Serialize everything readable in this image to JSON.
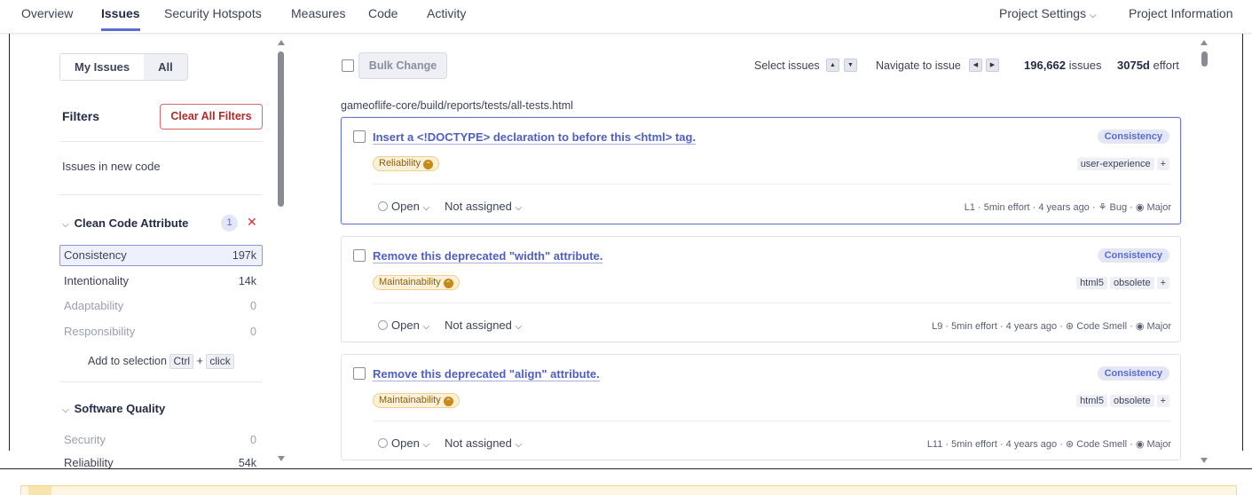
{
  "nav": {
    "tabs": [
      "Overview",
      "Issues",
      "Security Hotspots",
      "Measures",
      "Code",
      "Activity"
    ],
    "project_settings": "Project Settings",
    "project_information": "Project Information"
  },
  "sidebar": {
    "my_issues": "My Issues",
    "all": "All",
    "filters_title": "Filters",
    "clear_all": "Clear All Filters",
    "new_code": "Issues in new code",
    "clean_code": {
      "title": "Clean Code Attribute",
      "selected_count": "1",
      "items": [
        {
          "label": "Consistency",
          "count": "197k"
        },
        {
          "label": "Intentionality",
          "count": "14k"
        },
        {
          "label": "Adaptability",
          "count": "0"
        },
        {
          "label": "Responsibility",
          "count": "0"
        }
      ]
    },
    "add_selection": {
      "prefix": "Add to selection",
      "key": "Ctrl",
      "plus": "+",
      "action": "click"
    },
    "software_quality": {
      "title": "Software Quality",
      "items": [
        {
          "label": "Security",
          "count": "0"
        },
        {
          "label": "Reliability",
          "count": "54k"
        }
      ]
    }
  },
  "toolbar": {
    "bulk_change": "Bulk Change",
    "select_issues": "Select issues",
    "navigate_issue": "Navigate to issue",
    "issue_count": "196,662",
    "issues_label": "issues",
    "effort": "3075d",
    "effort_label": "effort"
  },
  "file_path": "gameoflife-core/build/reports/tests/all-tests.html",
  "issues": [
    {
      "title": "Insert a <!DOCTYPE> declaration to before this <html> tag.",
      "attribute": "Consistency",
      "quality": "Reliability",
      "tags": [
        "user-experience",
        "+"
      ],
      "status": "Open",
      "assignee": "Not assigned",
      "meta": "L1 · 5min effort · 4 years ago · ⚘ Bug · ◉ Major"
    },
    {
      "title": "Remove this deprecated \"width\" attribute.",
      "attribute": "Consistency",
      "quality": "Maintainability",
      "tags": [
        "html5",
        "obsolete",
        "+"
      ],
      "status": "Open",
      "assignee": "Not assigned",
      "meta": "L9 · 5min effort · 4 years ago · ⊛ Code Smell · ◉ Major"
    },
    {
      "title": "Remove this deprecated \"align\" attribute.",
      "attribute": "Consistency",
      "quality": "Maintainability",
      "tags": [
        "html5",
        "obsolete",
        "+"
      ],
      "status": "Open",
      "assignee": "Not assigned",
      "meta": "L11 · 5min effort · 4 years ago · ⊛ Code Smell · ◉ Major"
    }
  ],
  "colors": {
    "accent": "#5d6cd0",
    "danger": "#b02a2a",
    "quality_bg": "#fcf1d8"
  }
}
